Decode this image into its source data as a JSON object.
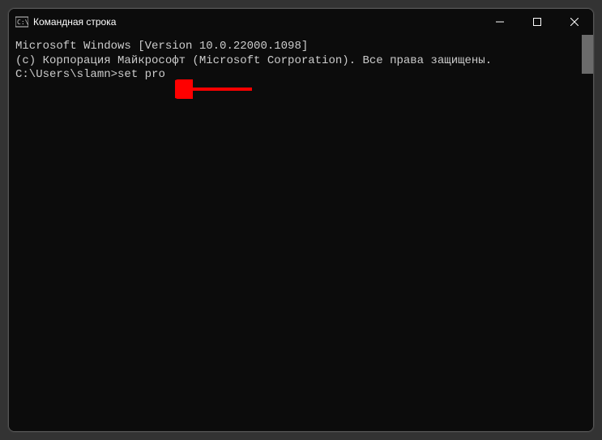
{
  "window": {
    "title": "Командная строка"
  },
  "terminal": {
    "line1": "Microsoft Windows [Version 10.0.22000.1098]",
    "line2": "(c) Корпорация Майкрософт (Microsoft Corporation). Все права защищены.",
    "blank": "",
    "prompt": "C:\\Users\\slamn>",
    "command": "set pro"
  },
  "annotation": {
    "arrow_color": "#ff0000"
  }
}
